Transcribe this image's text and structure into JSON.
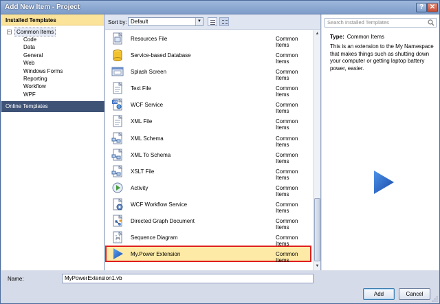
{
  "window": {
    "title": "Add New Item - Project"
  },
  "left": {
    "header": "Installed Templates",
    "root": {
      "toggle": "−",
      "label": "Common Items"
    },
    "children": [
      "Code",
      "Data",
      "General",
      "Web",
      "Windows Forms",
      "Reporting",
      "Workflow",
      "WPF"
    ],
    "online": "Online Templates"
  },
  "toolbar": {
    "sort_label": "Sort by:",
    "sort_value": "Default"
  },
  "templates": [
    {
      "name": "Resources File",
      "category": "Common Items",
      "icon": "resources-file-icon"
    },
    {
      "name": "Service-based Database",
      "category": "Common Items",
      "icon": "database-icon"
    },
    {
      "name": "Splash Screen",
      "category": "Common Items",
      "icon": "splash-screen-icon"
    },
    {
      "name": "Text File",
      "category": "Common Items",
      "icon": "text-file-icon"
    },
    {
      "name": "WCF Service",
      "category": "Common Items",
      "icon": "wcf-service-icon"
    },
    {
      "name": "XML File",
      "category": "Common Items",
      "icon": "xml-file-icon"
    },
    {
      "name": "XML Schema",
      "category": "Common Items",
      "icon": "xml-schema-icon"
    },
    {
      "name": "XML To Schema",
      "category": "Common Items",
      "icon": "xml-to-schema-icon"
    },
    {
      "name": "XSLT File",
      "category": "Common Items",
      "icon": "xslt-file-icon"
    },
    {
      "name": "Activity",
      "category": "Common Items",
      "icon": "activity-icon"
    },
    {
      "name": "WCF Workflow Service",
      "category": "Common Items",
      "icon": "wcf-workflow-icon"
    },
    {
      "name": "Directed Graph Document",
      "category": "Common Items",
      "icon": "graph-document-icon"
    },
    {
      "name": "Sequence Diagram",
      "category": "Common Items",
      "icon": "sequence-diagram-icon"
    },
    {
      "name": "My.Power Extension",
      "category": "Common Items",
      "icon": "play-arrow-icon",
      "selected": true
    }
  ],
  "search": {
    "placeholder": "Search Installed Templates"
  },
  "details": {
    "type_label": "Type:",
    "type_value": "Common Items",
    "description": "This is an extension to the My Namespace that makes things such as shutting down your computer or getting laptop battery power, easier."
  },
  "bottom": {
    "name_label": "Name:",
    "name_value": "MyPowerExtension1.vb",
    "add_label": "Add",
    "cancel_label": "Cancel"
  },
  "colors": {
    "selected_bg": "#fdeaa7",
    "selected_border": "#e01e1e",
    "header_bg": "#fbe39a",
    "online_bg": "#3f5377"
  }
}
